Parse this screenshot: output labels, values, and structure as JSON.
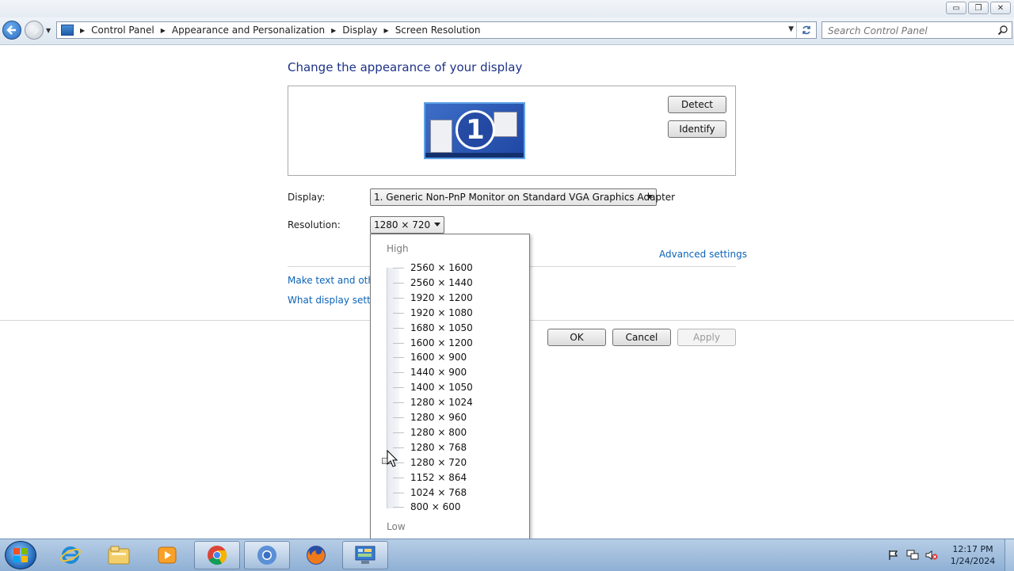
{
  "window": {
    "controls": {
      "minimize": "▭",
      "maximize": "❐",
      "close": "✕"
    }
  },
  "address_bar": {
    "breadcrumbs": [
      "Control Panel",
      "Appearance and Personalization",
      "Display",
      "Screen Resolution"
    ],
    "search_placeholder": "Search Control Panel"
  },
  "main": {
    "title": "Change the appearance of your display",
    "monitor_number": "1",
    "detect_label": "Detect",
    "identify_label": "Identify",
    "display_label": "Display:",
    "display_value": "1. Generic Non-PnP Monitor on Standard VGA Graphics Adapter",
    "resolution_label": "Resolution:",
    "resolution_value": "1280 × 720",
    "advanced_settings": "Advanced settings",
    "link_text_size": "Make text and other",
    "link_display_settings": "What display setting",
    "ok_label": "OK",
    "cancel_label": "Cancel",
    "apply_label": "Apply"
  },
  "resolution_dropdown": {
    "high_label": "High",
    "low_label": "Low",
    "options": [
      "2560 × 1600",
      "2560 × 1440",
      "1920 × 1200",
      "1920 × 1080",
      "1680 × 1050",
      "1600 × 1200",
      "1600 × 900",
      "1440 × 900",
      "1400 × 1050",
      "1280 × 1024",
      "1280 × 960",
      "1280 × 800",
      "1280 × 768",
      "1280 × 720",
      "1152 × 864",
      "1024 × 768",
      "800 × 600"
    ],
    "selected": "1280 × 720"
  },
  "taskbar": {
    "apps": [
      {
        "icon": "internet-explorer-icon"
      },
      {
        "icon": "file-explorer-icon"
      },
      {
        "icon": "media-player-icon"
      },
      {
        "icon": "chrome-icon"
      },
      {
        "icon": "chrome-alt-icon"
      },
      {
        "icon": "firefox-icon"
      },
      {
        "icon": "control-panel-icon"
      }
    ],
    "time": "12:17 PM",
    "date": "1/24/2024"
  },
  "colors": {
    "title_blue": "#1e3287",
    "link_blue": "#0d63b7"
  }
}
